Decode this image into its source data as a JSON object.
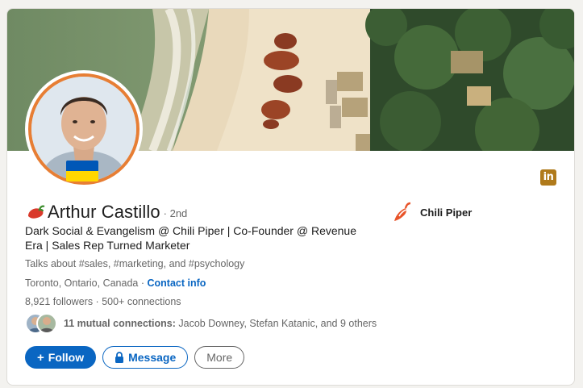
{
  "profile": {
    "name": "Arthur Castillo",
    "degree": "· 2nd",
    "headline": "Dark Social & Evangelism @ Chili Piper | Co-Founder @ Revenue Era | Sales Rep Turned Marketer",
    "talks_about": "Talks about #sales, #marketing, and #psychology",
    "location": "Toronto, Ontario, Canada",
    "location_sep": " · ",
    "contact_info": "Contact info",
    "followers": "8,921 followers",
    "connections": "500+ connections",
    "counts_sep": " · "
  },
  "mutual": {
    "count_label": "11 mutual connections:",
    "names": " Jacob Downey, Stefan Katanic, and 9 others"
  },
  "actions": {
    "follow_label": "Follow",
    "message_label": "Message",
    "more_label": "More"
  },
  "company": {
    "name": "Chili Piper"
  },
  "icons": {
    "linkedin": "in",
    "follow": "+",
    "message": "lock-icon",
    "name_emoji": "chili-pepper-icon"
  },
  "colors": {
    "accent": "#0a66c2",
    "avatar_ring": "#e77e34",
    "linkedin_badge": "#b07a1b",
    "flag_blue": "#0057b7",
    "flag_yellow": "#ffd700"
  }
}
